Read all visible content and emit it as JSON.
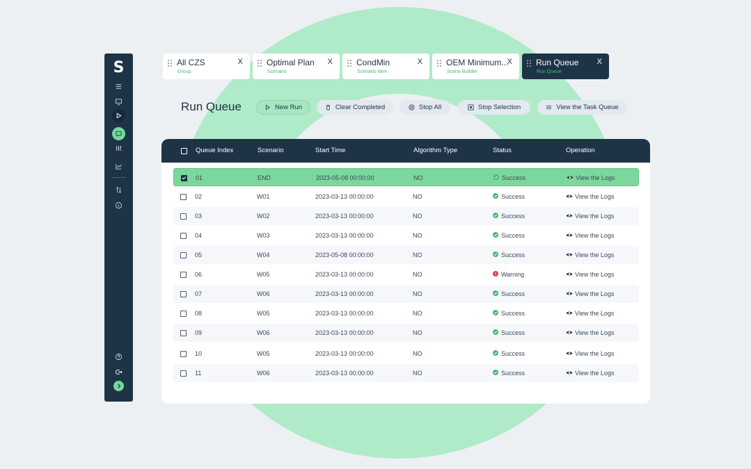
{
  "tabs": [
    {
      "title": "All CZS",
      "subtitle": "Group",
      "close": "X"
    },
    {
      "title": "Optimal Plan",
      "subtitle": "Scenario",
      "close": "X"
    },
    {
      "title": "CondMin",
      "subtitle": "Scenario Item",
      "close": "X"
    },
    {
      "title": "OEM Minimum...",
      "subtitle": "Scene Builder",
      "close": "X"
    },
    {
      "title": "Run Queue",
      "subtitle": "Run Queue",
      "close": "X"
    }
  ],
  "header": {
    "title": "Run Queue",
    "buttons": {
      "new_run": "New Run",
      "clear_completed": "Clear Completed",
      "stop_all": "Stop All",
      "stop_selection": "Stop Selection",
      "view_task_queue": "View the Task Queue"
    }
  },
  "sidebar": {
    "logo": "S",
    "icons": [
      "list-icon",
      "monitor-icon",
      "play-icon",
      "chat-icon",
      "sliders-icon",
      "chart-icon",
      "sort-icon",
      "info-icon",
      "help-icon",
      "logout-icon",
      "expand-icon"
    ]
  },
  "table": {
    "columns": [
      "Queue Index",
      "Scenario",
      "Start Time",
      "Algorithm Type",
      "Status",
      "Operation"
    ],
    "rows": [
      {
        "index": "01",
        "scenario": "END",
        "start": "2023-05-08 00:00:00",
        "algo": "NO",
        "status": "Success",
        "op": "View the Logs",
        "checked": true
      },
      {
        "index": "02",
        "scenario": "W01",
        "start": "2023-03-13 00:00:00",
        "algo": "NO",
        "status": "Success",
        "op": "View the Logs",
        "checked": false
      },
      {
        "index": "03",
        "scenario": "W02",
        "start": "2023-03-13 00:00:00",
        "algo": "NO",
        "status": "Success",
        "op": "View the Logs",
        "checked": false
      },
      {
        "index": "04",
        "scenario": "W03",
        "start": "2023-03-13 00:00:00",
        "algo": "NO",
        "status": "Success",
        "op": "View the Logs",
        "checked": false
      },
      {
        "index": "05",
        "scenario": "W04",
        "start": "2023-05-08 00:00:00",
        "algo": "NO",
        "status": "Success",
        "op": "View the Logs",
        "checked": false
      },
      {
        "index": "06",
        "scenario": "W05",
        "start": "2023-03-13 00:00:00",
        "algo": "NO",
        "status": "Warning",
        "op": "View the Logs",
        "checked": false
      },
      {
        "index": "07",
        "scenario": "W06",
        "start": "2023-03-13 00:00:00",
        "algo": "NO",
        "status": "Success",
        "op": "View the Logs",
        "checked": false
      },
      {
        "index": "08",
        "scenario": "W05",
        "start": "2023-03-13 00:00:00",
        "algo": "NO",
        "status": "Success",
        "op": "View the Logs",
        "checked": false
      },
      {
        "index": "09",
        "scenario": "W06",
        "start": "2023-03-13 00:00:00",
        "algo": "NO",
        "status": "Success",
        "op": "View the Logs",
        "checked": false
      },
      {
        "index": "10",
        "scenario": "W05",
        "start": "2023-03-13 00:00:00",
        "algo": "NO",
        "status": "Success",
        "op": "View the Logs",
        "checked": false
      },
      {
        "index": "11",
        "scenario": "W06",
        "start": "2023-03-13 00:00:00",
        "algo": "NO",
        "status": "Success",
        "op": "View the Logs",
        "checked": false
      }
    ]
  },
  "colors": {
    "navy": "#1e3446",
    "accent_green": "#7cd79d",
    "success": "#46b973",
    "warning": "#e0404a",
    "ring": "#afebc8"
  }
}
